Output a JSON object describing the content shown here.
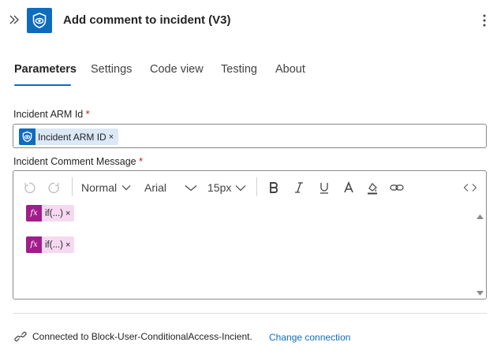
{
  "header": {
    "title": "Add comment to incident (V3)",
    "icon": "sentinel-shield-icon",
    "brand_color": "#0f6cbd"
  },
  "tabs": [
    {
      "label": "Parameters",
      "active": true
    },
    {
      "label": "Settings",
      "active": false
    },
    {
      "label": "Code view",
      "active": false
    },
    {
      "label": "Testing",
      "active": false
    },
    {
      "label": "About",
      "active": false
    }
  ],
  "fields": {
    "arm_id": {
      "label": "Incident ARM Id",
      "required": "*",
      "token": "Incident ARM ID",
      "remove": "×"
    },
    "comment": {
      "label": "Incident Comment Message",
      "required": "*",
      "toolbar": {
        "block_format": "Normal",
        "font_family": "Arial",
        "font_size": "15px",
        "buttons": [
          "undo-icon",
          "redo-icon",
          "bold-icon",
          "italic-icon",
          "underline-icon",
          "text-color-icon",
          "highlight-icon",
          "link-icon",
          "code-view-icon"
        ]
      },
      "tokens": [
        {
          "badge": "fx",
          "text": "if(...)",
          "remove": "×"
        },
        {
          "badge": "fx",
          "text": "if(...)",
          "remove": "×"
        }
      ],
      "expression_color": "#a01d8a"
    }
  },
  "connection": {
    "text": "Connected to Block-User-ConditionalAccess-Incient.",
    "link": "Change connection"
  }
}
